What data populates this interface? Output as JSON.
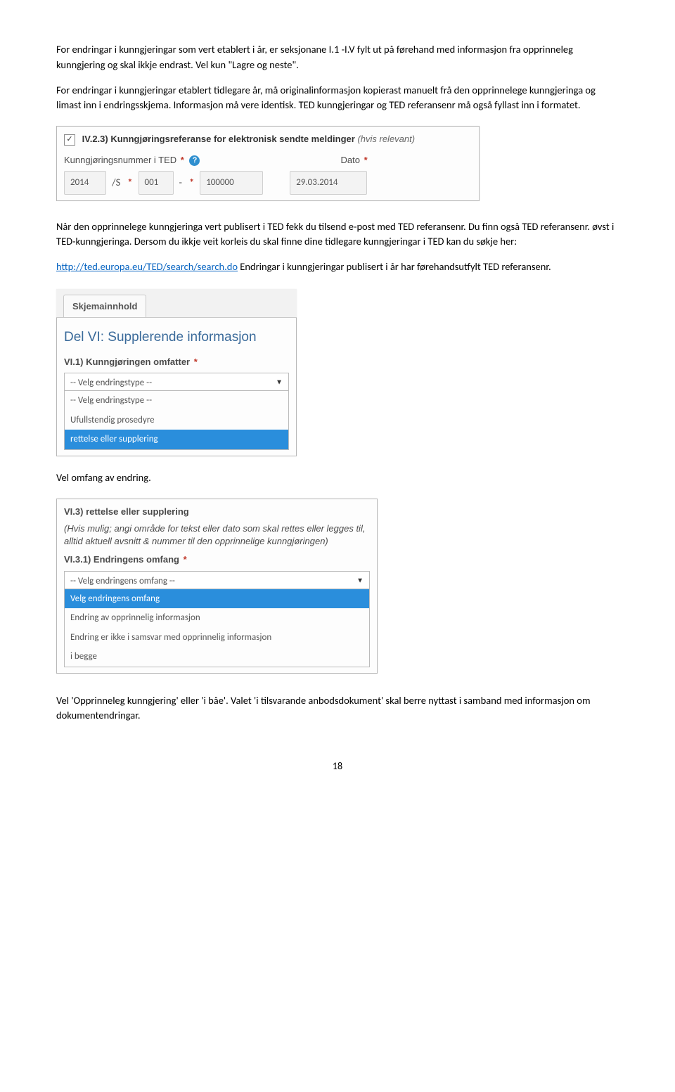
{
  "para1": "For endringar i kunngjeringar  som vert etablert i år, er seksjonane  I.1 -I.V  fylt ut på førehand med informasjon fra opprinneleg kunngjering og  skal ikkje endrast.  Vel  kun \"Lagre og neste\".",
  "para2": "For endringar i kunngjeringar etablert  tidlegare år, må originalinformasjon kopierast manuelt frå den opprinnelege kunngjeringa og limast inn i endringsskjema.  Informasjon må vere identisk. TED kunngjeringar og TED referansenr må også fyllast inn i formatet.",
  "shot1": {
    "heading_strong": "IV.2.3) Kunngjøringsreferanse for elektronisk sendte meldinger",
    "heading_grey": " (hvis relevant)",
    "label_ted": "Kunngjøringsnummer i TED",
    "label_dato": "Dato",
    "val_year": "2014",
    "val_sep1": "/S",
    "val_s": "001",
    "val_sep2": "-",
    "val_n": "100000",
    "val_date": "29.03.2014",
    "checkbox_mark": "✓"
  },
  "para3_a": "Når den opprinnelege kunngjeringa  vert publisert  i TED fekk  du tilsend e-post med TED referansenr.  Du finn også TED referansenr.  øvst i TED-kunngjeringa.  Dersom du ikkje veit korleis du skal finne dine tidlegare kunngjeringar i TED  kan du søkje her:",
  "link_text": "http://ted.europa.eu/TED/search/search.do",
  "para3_b": "  Endringar i kunngjeringar  publisert i år har førehandsutfylt  TED referansenr.",
  "shot2": {
    "tab": "Skjemainnhold",
    "h2": "Del VI: Supplerende informasjon",
    "label": "VI.1) Kunngjøringen omfatter",
    "selected": "-- Velg endringstype --",
    "opt1": "-- Velg endringstype --",
    "opt2": "Ufullstendig prosedyre",
    "opt3": "rettelse eller supplering"
  },
  "para4": "Vel omfang av endring.",
  "shot3": {
    "title": "VI.3) rettelse eller supplering",
    "grey": "(Hvis mulig; angi område for tekst eller dato som skal rettes eller legges til, alltid aktuell avsnitt & nummer til den opprinnelige kunngjøringen)",
    "label": "VI.3.1) Endringens omfang",
    "selected": "-- Velg endringens omfang --",
    "opt1": "Velg endringens omfang",
    "opt2": "Endring av opprinnelig informasjon",
    "opt3": "Endring er ikke i samsvar med opprinnelig informasjon",
    "opt4": "i begge"
  },
  "para5": "Vel   'Opprinneleg kunngjering' eller 'i  båe'. Valet 'i tilsvarande anbodsdokument' skal berre nyttast i samband med informasjon om dokumentendringar.",
  "page_number": "18"
}
